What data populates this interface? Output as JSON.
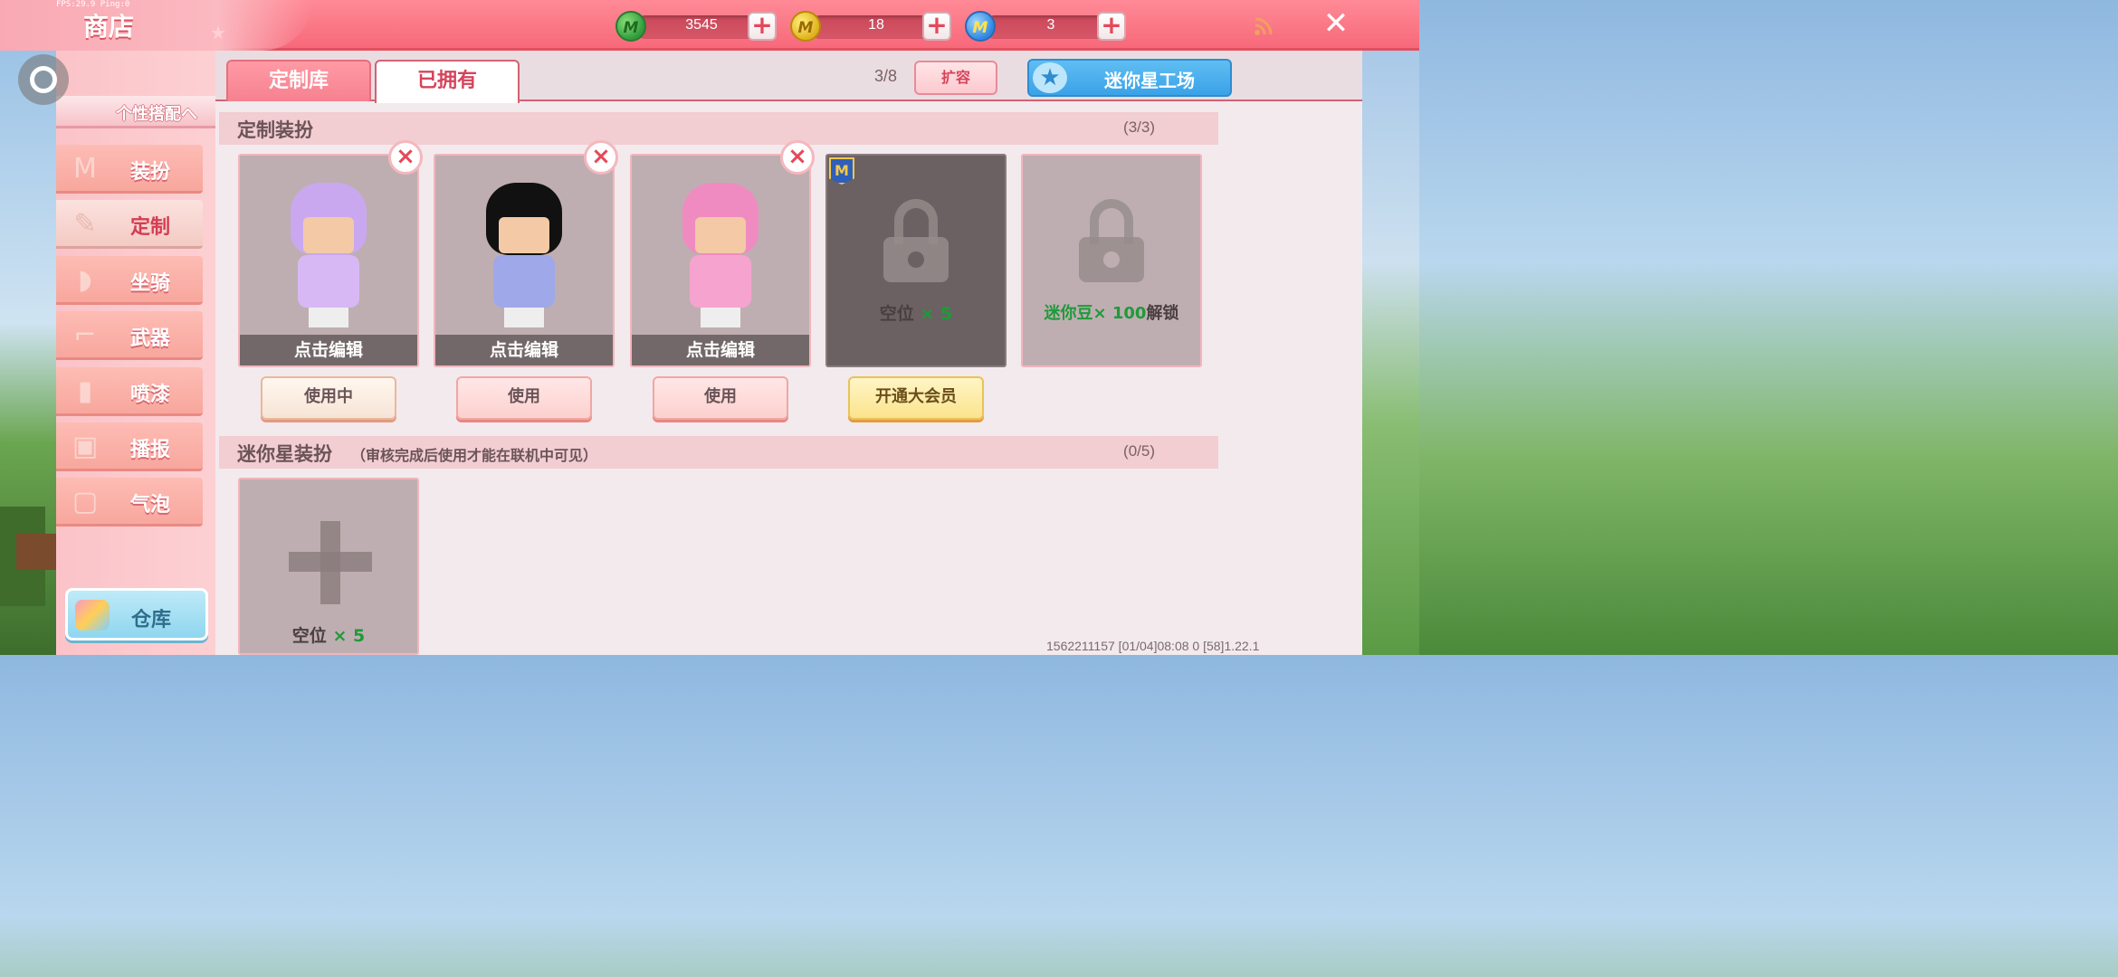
{
  "debug": {
    "fps_text": "FPS:29.9  Ping:0"
  },
  "header": {
    "title": "商店",
    "currencies": [
      {
        "icon": "green-mini-coin-icon",
        "value": "3545",
        "coin_letter": "M"
      },
      {
        "icon": "gold-coin-icon",
        "value": "18",
        "coin_letter": "M"
      },
      {
        "icon": "blue-mini-coin-icon",
        "value": "3",
        "coin_letter": "M"
      }
    ],
    "plus_symbol": "+",
    "close_symbol": "✕",
    "rss_icon": "rss-icon"
  },
  "sidebar": {
    "group_label": "个性搭配へ",
    "items": [
      {
        "label": "装扮",
        "icon": "shirt-icon",
        "glyph": "M"
      },
      {
        "label": "定制",
        "icon": "palette-icon",
        "glyph": "✎"
      },
      {
        "label": "坐骑",
        "icon": "mount-icon",
        "glyph": "◗"
      },
      {
        "label": "武器",
        "icon": "gun-icon",
        "glyph": "⌐"
      },
      {
        "label": "喷漆",
        "icon": "spray-can-icon",
        "glyph": "▮"
      },
      {
        "label": "播报",
        "icon": "broadcast-box-icon",
        "glyph": "▣"
      },
      {
        "label": "气泡",
        "icon": "bubble-box-icon",
        "glyph": "▢"
      }
    ],
    "active_index": 1,
    "warehouse_label": "仓库"
  },
  "tabs": [
    {
      "label": "定制库",
      "active": false
    },
    {
      "label": "已拥有",
      "active": true
    }
  ],
  "toolbar": {
    "capacity": "3/8",
    "expand_label": "扩容",
    "workshop_label": "迷你星工场",
    "workshop_icon": "star-icon"
  },
  "custom_section": {
    "title": "定制装扮",
    "count": "(3/3)",
    "cards": [
      {
        "edit_label": "点击编辑",
        "button": "使用中",
        "hair": "#c9a8f0",
        "outfit": "#d8b8f4"
      },
      {
        "edit_label": "点击编辑",
        "button": "使用",
        "hair": "#111111",
        "outfit": "#9fa8e8"
      },
      {
        "edit_label": "点击编辑",
        "button": "使用",
        "hair": "#f08bc1",
        "outfit": "#f7a3cf"
      }
    ],
    "vip_slot": {
      "badge": "M",
      "slot_label": "空位",
      "slot_count": "× 5",
      "button": "开通大会员"
    },
    "locked_slot": {
      "currency": "迷你豆",
      "amount": "× 100",
      "action": "解锁"
    }
  },
  "star_section": {
    "title": "迷你星装扮",
    "note": "（审核完成后使用才能在联机中可见）",
    "count": "(0/5)",
    "add_slot": {
      "slot_label": "空位",
      "slot_count": "× 5"
    }
  },
  "footer": {
    "info": "1562211157     [01/04]08:08 0  [58]1.22.1"
  }
}
